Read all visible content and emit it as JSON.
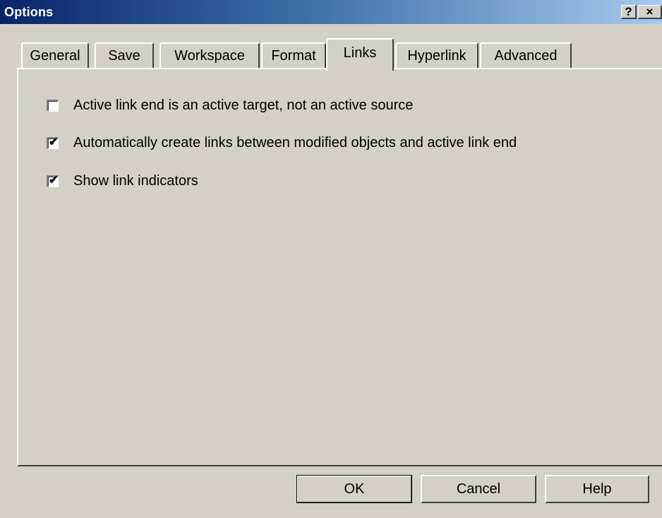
{
  "window": {
    "title": "Options",
    "help_button": "?",
    "close_button": "×"
  },
  "tabs": [
    {
      "label": "General",
      "active": false
    },
    {
      "label": "Save",
      "active": false
    },
    {
      "label": "Workspace",
      "active": false
    },
    {
      "label": "Format",
      "active": false
    },
    {
      "label": "Links",
      "active": true
    },
    {
      "label": "Hyperlink",
      "active": false
    },
    {
      "label": "Advanced",
      "active": false
    }
  ],
  "links_panel": {
    "options": [
      {
        "label": "Active link end is an active target, not an active source",
        "checked": false
      },
      {
        "label": "Automatically create links between modified objects and active link end",
        "checked": true
      },
      {
        "label": "Show link indicators",
        "checked": true
      }
    ]
  },
  "buttons": {
    "ok": "OK",
    "cancel": "Cancel",
    "help": "Help"
  },
  "colors": {
    "titlebar_start": "#0a246a",
    "titlebar_end": "#a6caf0",
    "face": "#d4d0c8"
  },
  "icons": {
    "check": "checkmark-icon"
  }
}
